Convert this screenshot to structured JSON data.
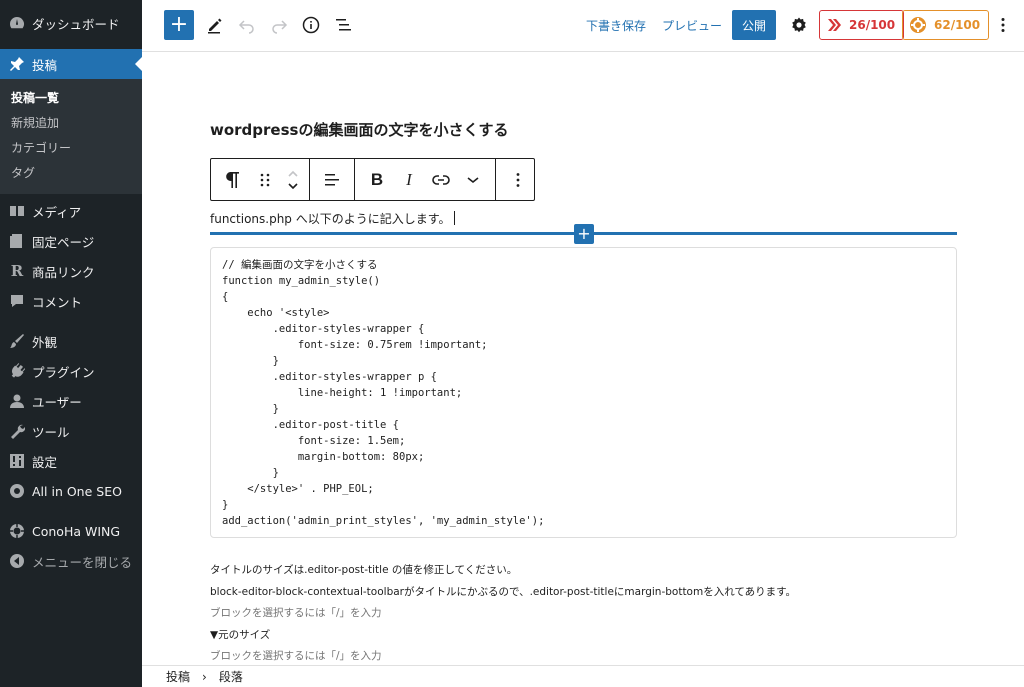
{
  "sidebar": {
    "dashboard": "ダッシュボード",
    "posts": "投稿",
    "submenu": [
      "投稿一覧",
      "新規追加",
      "カテゴリー",
      "タグ"
    ],
    "items": [
      {
        "label": "メディア",
        "icon": "media-icon"
      },
      {
        "label": "固定ページ",
        "icon": "page-icon"
      },
      {
        "label": "商品リンク",
        "icon": "rinker-icon"
      },
      {
        "label": "コメント",
        "icon": "comment-icon"
      },
      {
        "label": "外観",
        "icon": "appearance-icon"
      },
      {
        "label": "プラグイン",
        "icon": "plugin-icon"
      },
      {
        "label": "ユーザー",
        "icon": "user-icon"
      },
      {
        "label": "ツール",
        "icon": "tools-icon"
      },
      {
        "label": "設定",
        "icon": "settings-icon"
      },
      {
        "label": "All in One SEO",
        "icon": "aioseo-icon"
      },
      {
        "label": "ConoHa WING",
        "icon": "conoha-icon"
      },
      {
        "label": "メニューを閉じる",
        "icon": "collapse-icon"
      }
    ]
  },
  "toolbar": {
    "save_draft": "下書き保存",
    "preview": "プレビュー",
    "publish": "公開",
    "score_1": "26/100",
    "score_2": "62/100"
  },
  "editor": {
    "title": "wordpressの編集画面の文字を小さくする",
    "active_paragraph": "functions.php へ以下のように記入します。",
    "code": "// 編集画面の文字を小さくする\nfunction my_admin_style()\n{\n    echo '<style>\n        .editor-styles-wrapper {\n            font-size: 0.75rem !important;\n        }\n        .editor-styles-wrapper p {\n            line-height: 1 !important;\n        }\n        .editor-post-title {\n            font-size: 1.5em;\n            margin-bottom: 80px;\n        }\n    </style>' . PHP_EOL;\n}\nadd_action('admin_print_styles', 'my_admin_style');",
    "para_1": "タイトルのサイズは.editor-post-title の値を修正してください。",
    "para_2": "block-editor-block-contextual-toolbarがタイトルにかぶるので、.editor-post-titleにmargin-bottomを入れてあります。",
    "placeholder_1": "ブロックを選択するには「/」を入力",
    "para_3": "▼元のサイズ",
    "placeholder_2": "ブロックを選択するには「/」を入力"
  },
  "breadcrumb": {
    "root": "投稿",
    "separator": "›",
    "current": "段落"
  },
  "colors": {
    "admin_bg": "#1d2327",
    "accent": "#2271b1",
    "score_red": "#d63638",
    "score_orange": "#e4902a"
  }
}
